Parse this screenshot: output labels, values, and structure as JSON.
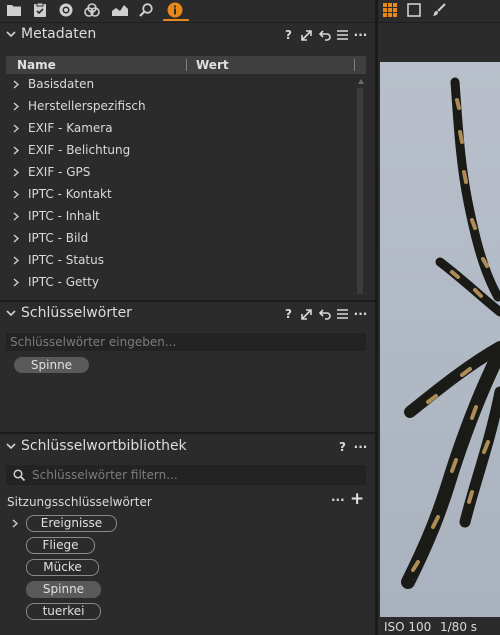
{
  "metadata_panel": {
    "title": "Metadaten",
    "columns": {
      "name": "Name",
      "value": "Wert"
    },
    "rows": [
      "Basisdaten",
      "Herstellerspezifisch",
      "EXIF - Kamera",
      "EXIF - Belichtung",
      "EXIF - GPS",
      "IPTC - Kontakt",
      "IPTC - Inhalt",
      "IPTC - Bild",
      "IPTC - Status",
      "IPTC - Getty"
    ]
  },
  "keywords_panel": {
    "title": "Schlüsselwörter",
    "placeholder": "Schlüsselwörter eingeben...",
    "keyword": "Spinne"
  },
  "library_panel": {
    "title": "Schlüsselwortbibliothek",
    "search_placeholder": "Schlüsselwörter filtern...",
    "group_label": "Sitzungsschlüsselwörter",
    "keywords": [
      "Ereignisse",
      "Fliege",
      "Mücke",
      "Spinne",
      "tuerkei"
    ]
  },
  "header_icons": {
    "help": "?",
    "more": "···",
    "add": "+"
  },
  "status": {
    "iso": "ISO 100",
    "shutter": "1/80 s"
  },
  "colors": {
    "accent": "#e8881b",
    "background": "#2b2b2b"
  }
}
